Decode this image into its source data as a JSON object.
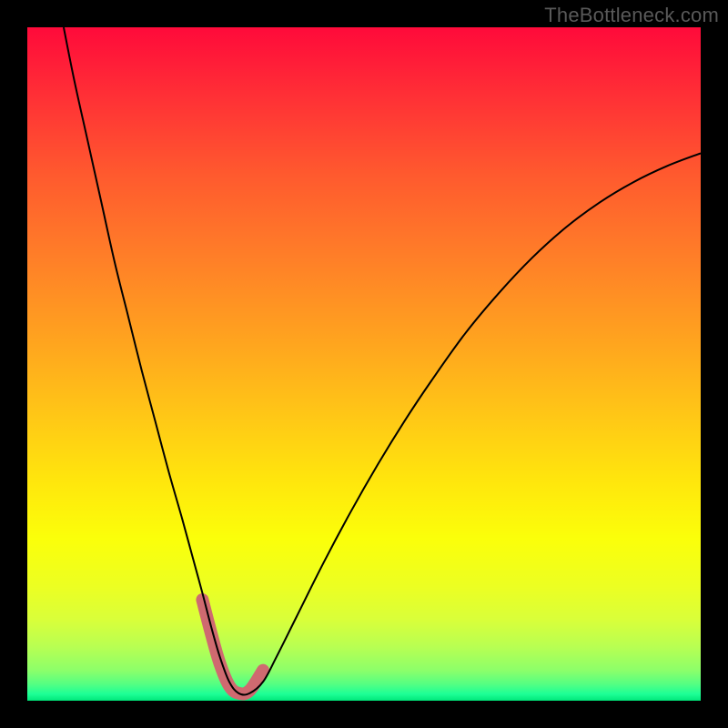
{
  "watermark": {
    "text": "TheBottleneck.com"
  },
  "gradient": {
    "stops": [
      {
        "p": 0.0,
        "c": "#ff0a3a"
      },
      {
        "p": 0.1,
        "c": "#ff2f36"
      },
      {
        "p": 0.22,
        "c": "#ff5a2e"
      },
      {
        "p": 0.34,
        "c": "#ff7e28"
      },
      {
        "p": 0.46,
        "c": "#ffa21f"
      },
      {
        "p": 0.58,
        "c": "#ffc816"
      },
      {
        "p": 0.68,
        "c": "#ffe80c"
      },
      {
        "p": 0.76,
        "c": "#fbff0a"
      },
      {
        "p": 0.83,
        "c": "#ecff22"
      },
      {
        "p": 0.88,
        "c": "#d9ff3a"
      },
      {
        "p": 0.92,
        "c": "#b8ff52"
      },
      {
        "p": 0.955,
        "c": "#8cff6a"
      },
      {
        "p": 0.975,
        "c": "#55ff82"
      },
      {
        "p": 0.99,
        "c": "#1dff96"
      },
      {
        "p": 1.0,
        "c": "#00e77a"
      }
    ]
  },
  "chart_data": {
    "type": "line",
    "title": "",
    "xlabel": "",
    "ylabel": "",
    "ylim": [
      0,
      100
    ],
    "xlim": [
      0,
      100
    ],
    "series": [
      {
        "name": "bottleneck-curve",
        "stroke": "#000000",
        "stroke_width": 2,
        "x": [
          5.4,
          7,
          9,
          11,
          13,
          15,
          17,
          19,
          21,
          23,
          24.5,
          26,
          27.3,
          28.6,
          30,
          31.4,
          33,
          35,
          37,
          40,
          44,
          48,
          52,
          56,
          60,
          65,
          70,
          75,
          80,
          85,
          90,
          95,
          100
        ],
        "y": [
          100,
          92,
          83,
          74,
          65,
          57,
          49,
          41.5,
          34,
          27,
          21.5,
          16,
          11,
          6.5,
          2.8,
          1.1,
          1.1,
          2.8,
          6.5,
          12.5,
          20.5,
          28,
          35,
          41.5,
          47.5,
          54.5,
          60.5,
          65.8,
          70.3,
          74,
          77,
          79.4,
          81.3
        ]
      },
      {
        "name": "valley-highlight",
        "stroke": "#cf6a70",
        "stroke_width": 14,
        "linecap": "round",
        "x": [
          26,
          27.3,
          28.6,
          30,
          31.4,
          33,
          35
        ],
        "y": [
          15,
          10,
          5.5,
          2.2,
          1.1,
          1.5,
          4.5
        ]
      }
    ]
  }
}
